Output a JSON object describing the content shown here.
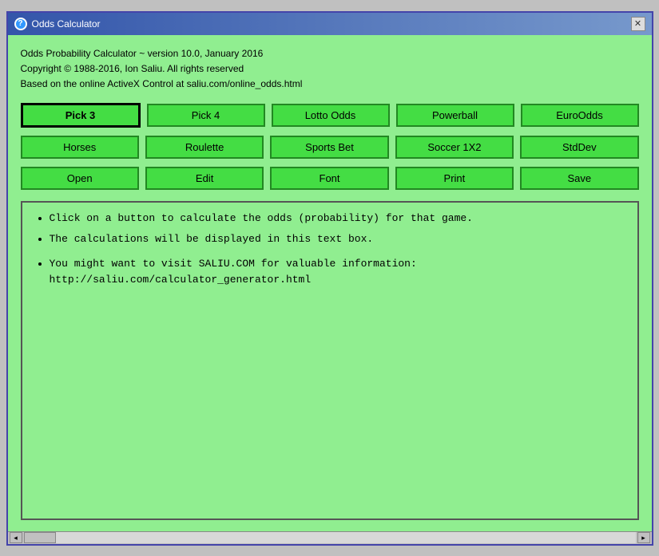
{
  "window": {
    "title": "Odds Calculator",
    "close_label": "✕"
  },
  "info": {
    "line1": "Odds Probability Calculator ~ version 10.0, January 2016",
    "line2": "Copyright © 1988-2016, Ion Saliu. All rights reserved",
    "line3": "Based on the online ActiveX Control at saliu.com/online_odds.html"
  },
  "buttons_row1": [
    {
      "label": "Pick 3",
      "name": "pick3-button",
      "active": true
    },
    {
      "label": "Pick 4",
      "name": "pick4-button"
    },
    {
      "label": "Lotto Odds",
      "name": "lotto-odds-button"
    },
    {
      "label": "Powerball",
      "name": "powerball-button"
    },
    {
      "label": "EuroOdds",
      "name": "euroOdds-button"
    }
  ],
  "buttons_row2": [
    {
      "label": "Horses",
      "name": "horses-button"
    },
    {
      "label": "Roulette",
      "name": "roulette-button"
    },
    {
      "label": "Sports Bet",
      "name": "sports-bet-button"
    },
    {
      "label": "Soccer 1X2",
      "name": "soccer-button"
    },
    {
      "label": "StdDev",
      "name": "stddev-button"
    }
  ],
  "buttons_row3": [
    {
      "label": "Open",
      "name": "open-button"
    },
    {
      "label": "Edit",
      "name": "edit-button"
    },
    {
      "label": "Font",
      "name": "font-button"
    },
    {
      "label": "Print",
      "name": "print-button"
    },
    {
      "label": "Save",
      "name": "save-button"
    }
  ],
  "output": {
    "bullet1": "Click on a button to calculate the odds (probability) for that game.",
    "bullet2": "The calculations will be displayed in this text box.",
    "bullet3": "You might want to visit SALIU.COM for valuable information:",
    "url": "http://saliu.com/calculator_generator.html"
  }
}
